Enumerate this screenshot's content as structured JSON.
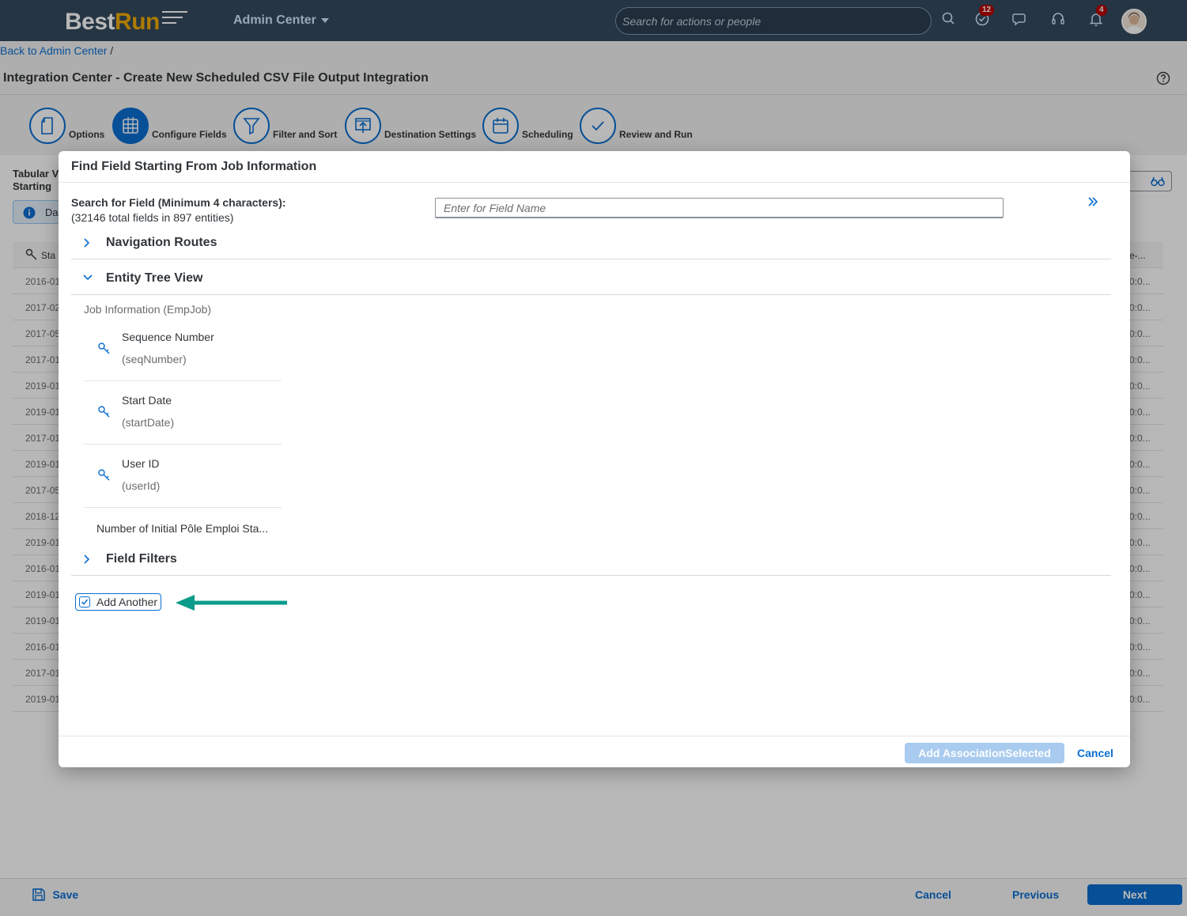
{
  "shell": {
    "logo_best": "Best",
    "logo_run": "Run",
    "app_menu": "Admin Center",
    "search_placeholder": "Search for actions or people",
    "tasks_badge": "12",
    "notifications_badge": "4"
  },
  "breadcrumb": {
    "link": "Back to Admin Center",
    "separator": "/"
  },
  "page": {
    "title": "Integration Center - Create New Scheduled CSV File Output Integration"
  },
  "steps": [
    {
      "label": "Options",
      "icon": "document-icon"
    },
    {
      "label": "Configure Fields",
      "icon": "grid-icon",
      "active": true
    },
    {
      "label": "Filter and Sort",
      "icon": "filter-icon"
    },
    {
      "label": "Destination Settings",
      "icon": "upload-icon"
    },
    {
      "label": "Scheduling",
      "icon": "calendar-icon"
    },
    {
      "label": "Review and Run",
      "icon": "checkmark-icon"
    }
  ],
  "background": {
    "tab_line1": "Tabular V",
    "tab_line2": "Starting",
    "info_strip": "Da",
    "column_start": "Sta",
    "column_end": "e-...",
    "rows": [
      "2016-01",
      "2017-02",
      "2017-05",
      "2017-01",
      "2019-01",
      "2019-01",
      "2017-01",
      "2019-01",
      "2017-05",
      "2018-12",
      "2019-01",
      "2016-01",
      "2019-01",
      "2019-01",
      "2016-01",
      "2017-01",
      "2019-01"
    ],
    "row_end": "0:0..."
  },
  "dialog": {
    "title": "Find Field Starting From Job Information",
    "search_label": "Search for Field (Minimum 4 characters):",
    "search_stats": "(32146 total fields in 897 entities)",
    "search_placeholder": "Enter for Field Name",
    "panels": {
      "navigation": "Navigation Routes",
      "entity_tree": "Entity Tree View",
      "filters": "Field Filters"
    },
    "tree_root": "Job Information (EmpJob)",
    "tree_items": [
      {
        "name": "Sequence Number",
        "tech": "(seqNumber)"
      },
      {
        "name": "Start Date",
        "tech": "(startDate)"
      },
      {
        "name": "User ID",
        "tech": "(userId)"
      }
    ],
    "tree_more": "Number of Initial Pôle Emploi Sta...",
    "add_another": "Add Another",
    "add_another_checked": true,
    "primary_button": "Add AssociationSelected Field",
    "cancel_button": "Cancel"
  },
  "footer": {
    "save": "Save",
    "cancel": "Cancel",
    "previous": "Previous",
    "next": "Next"
  },
  "colors": {
    "shell": "#354a5f",
    "accent": "#0a6ed1",
    "arrow": "#0a9b8a",
    "badge": "#bb0000"
  }
}
